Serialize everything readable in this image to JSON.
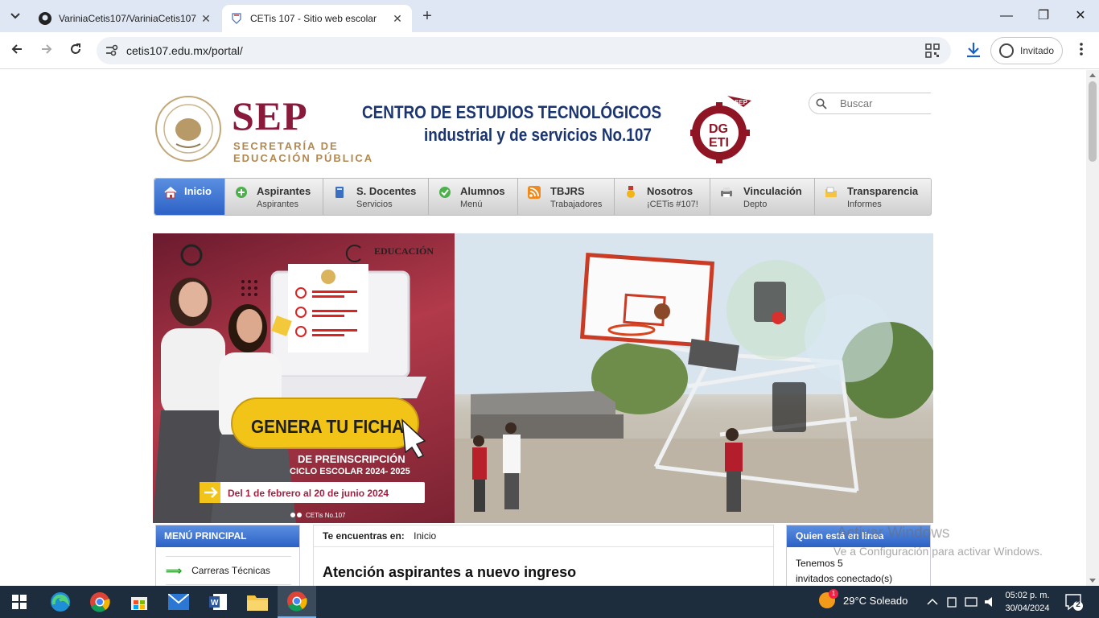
{
  "browser": {
    "tabs": [
      {
        "title": "VariniaCetis107/VariniaCetis107",
        "close": "✕"
      },
      {
        "title": "CETis 107 - Sitio web escolar",
        "close": "✕"
      }
    ],
    "new_tab": "+",
    "window_controls": {
      "minimize": "—",
      "restore": "❐",
      "close": "✕"
    },
    "url": "cetis107.edu.mx/portal/",
    "profile_label": "Invitado"
  },
  "header": {
    "sep_logo": "SEP",
    "sep_line1": "SECRETARÍA DE",
    "sep_line2": "EDUCACIÓN PÚBLICA",
    "school_line1": "CENTRO DE ESTUDIOS TECNOLÓGICOS",
    "school_line2": "industrial y de servicios No.107",
    "dgeti_top": "SEP",
    "dgeti_mid": "DG",
    "dgeti_bot": "ETI",
    "search_placeholder": "Buscar"
  },
  "nav": [
    {
      "label": "Inicio",
      "sub": ""
    },
    {
      "label": "Aspirantes",
      "sub": "Aspirantes"
    },
    {
      "label": "S. Docentes",
      "sub": "Servicios"
    },
    {
      "label": "Alumnos",
      "sub": "Menú"
    },
    {
      "label": "TBJRS",
      "sub": "Trabajadores"
    },
    {
      "label": "Nosotros",
      "sub": "¡CETis #107!"
    },
    {
      "label": "Vinculación",
      "sub": "Depto"
    },
    {
      "label": "Transparencia",
      "sub": "Informes"
    }
  ],
  "banner": {
    "brand": "EDUCACIÓN",
    "cta": "GENERA TU FICHA",
    "line1": "DE PREINSCRIPCIÓN",
    "line2": "CICLO ESCOLAR 2024- 2025",
    "dates": "Del 1 de febrero al 20 de junio 2024",
    "social": "CETis No.107"
  },
  "menu": {
    "title": "MENÚ PRINCIPAL",
    "items": [
      "Carreras Técnicas"
    ]
  },
  "content": {
    "breadcrumb_label": "Te encuentras en:",
    "breadcrumb_value": "Inicio",
    "title": "Atención aspirantes a nuevo ingreso"
  },
  "who": {
    "title": "Quien está en linea",
    "line1": "Tenemos 5",
    "line2": "invitados conectado(s)"
  },
  "watermark": {
    "line1": "Activar Windows",
    "line2": "Ve a Configuración para activar Windows."
  },
  "taskbar": {
    "weather_badge": "1",
    "weather": "29°C  Soleado",
    "time": "05:02 p. m.",
    "date": "30/04/2024",
    "notifications": "2"
  },
  "colors": {
    "sep": "#8a1a3c",
    "school": "#1a3570",
    "nav_active": "#2d62c6"
  }
}
